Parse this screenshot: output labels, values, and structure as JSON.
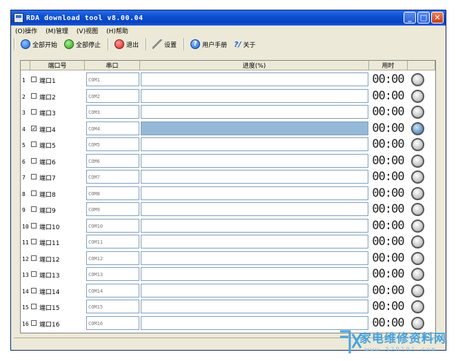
{
  "window": {
    "title": "RDA download tool v8.00.04"
  },
  "menu": [
    "(O)操作",
    "(M)管理",
    "(V)视图",
    "(H)帮助"
  ],
  "toolbar": {
    "start_all": "全部开始",
    "stop_all": "全部停止",
    "exit": "退出",
    "settings": "设置",
    "manual": "用户手册",
    "about": "关于"
  },
  "columns": {
    "port": "端口号",
    "com": "串口",
    "progress": "进度(%)",
    "time": "用时"
  },
  "rows": [
    {
      "num": "1",
      "port": "端口1",
      "com": "COM1",
      "checked": false,
      "time": "00:00",
      "active": false
    },
    {
      "num": "2",
      "port": "端口2",
      "com": "COM2",
      "checked": false,
      "time": "00:00",
      "active": false
    },
    {
      "num": "3",
      "port": "端口3",
      "com": "COM3",
      "checked": false,
      "time": "00:00",
      "active": false
    },
    {
      "num": "4",
      "port": "端口4",
      "com": "COM4",
      "checked": true,
      "time": "00:00",
      "active": true
    },
    {
      "num": "5",
      "port": "端口5",
      "com": "COM5",
      "checked": false,
      "time": "00:00",
      "active": false
    },
    {
      "num": "6",
      "port": "端口6",
      "com": "COM6",
      "checked": false,
      "time": "00:00",
      "active": false
    },
    {
      "num": "7",
      "port": "端口7",
      "com": "COM7",
      "checked": false,
      "time": "00:00",
      "active": false
    },
    {
      "num": "8",
      "port": "端口8",
      "com": "COM8",
      "checked": false,
      "time": "00:00",
      "active": false
    },
    {
      "num": "9",
      "port": "端口9",
      "com": "COM9",
      "checked": false,
      "time": "00:00",
      "active": false
    },
    {
      "num": "10",
      "port": "端口10",
      "com": "COM10",
      "checked": false,
      "time": "00:00",
      "active": false
    },
    {
      "num": "11",
      "port": "端口11",
      "com": "COM11",
      "checked": false,
      "time": "00:00",
      "active": false
    },
    {
      "num": "12",
      "port": "端口12",
      "com": "COM12",
      "checked": false,
      "time": "00:00",
      "active": false
    },
    {
      "num": "13",
      "port": "端口13",
      "com": "COM13",
      "checked": false,
      "time": "00:00",
      "active": false
    },
    {
      "num": "14",
      "port": "端口14",
      "com": "COM14",
      "checked": false,
      "time": "00:00",
      "active": false
    },
    {
      "num": "15",
      "port": "端口15",
      "com": "COM15",
      "checked": false,
      "time": "00:00",
      "active": false
    },
    {
      "num": "16",
      "port": "端口16",
      "com": "COM16",
      "checked": false,
      "time": "00:00",
      "active": false
    }
  ],
  "colors": {
    "progress_active": "#95b9d8"
  },
  "watermark": {
    "text": "家电维修资料网",
    "url": "www.520101.com"
  }
}
